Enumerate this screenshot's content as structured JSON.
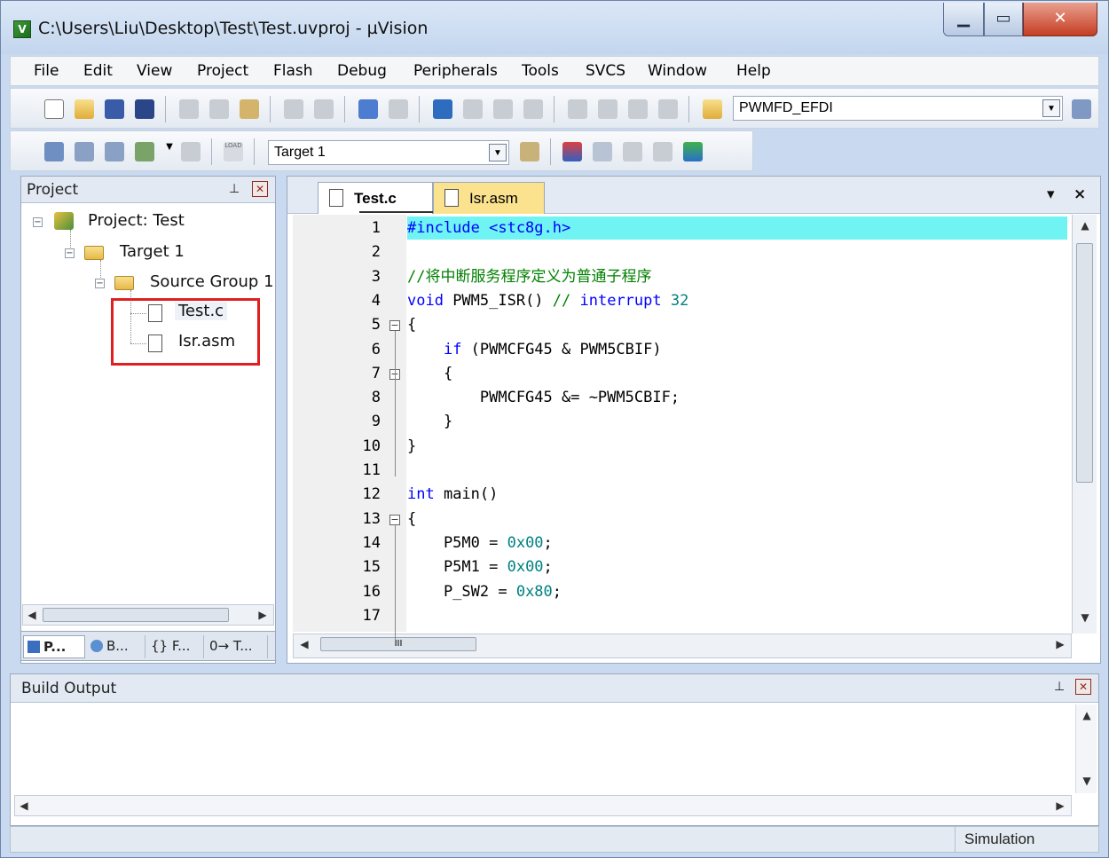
{
  "window": {
    "title": "C:\\Users\\Liu\\Desktop\\Test\\Test.uvproj - µVision",
    "app_icon_letter": "V"
  },
  "menu": [
    "File",
    "Edit",
    "View",
    "Project",
    "Flash",
    "Debug",
    "Peripherals",
    "Tools",
    "SVCS",
    "Window",
    "Help"
  ],
  "toolbar1": {
    "find_combo_value": "PWMFD_EFDI"
  },
  "toolbar2": {
    "target_combo_value": "Target 1",
    "load_label": "LOAD"
  },
  "project_panel": {
    "title": "Project",
    "tree": {
      "project": "Project: Test",
      "target": "Target 1",
      "group": "Source Group 1",
      "files": [
        "Test.c",
        "Isr.asm"
      ]
    },
    "tabs": [
      "P...",
      "B...",
      "{} F...",
      "0→ T..."
    ]
  },
  "editor": {
    "tabs": [
      {
        "label": "Test.c",
        "active": true
      },
      {
        "label": "Isr.asm",
        "active": false
      }
    ],
    "tab_menu_glyph": "▾",
    "tab_close_glyph": "×",
    "line_numbers": [
      "1",
      "2",
      "3",
      "4",
      "5",
      "6",
      "7",
      "8",
      "9",
      "10",
      "11",
      "12",
      "13",
      "14",
      "15",
      "16",
      "17"
    ],
    "lines": [
      "#include <stc8g.h>",
      "",
      "//将中断服务程序定义为普通子程序",
      "void PWM5_ISR() // interrupt 32",
      "{",
      "    if (PWMCFG45 & PWM5CBIF)",
      "    {",
      "        PWMCFG45 &= ~PWM5CBIF;",
      "    }",
      "}",
      "",
      "int main()",
      "{",
      "    P5M0 = 0x00;",
      "    P5M1 = 0x00;",
      "    P_SW2 = 0x80;",
      ""
    ],
    "scroll_mid_glyph": "III"
  },
  "build_output": {
    "title": "Build Output"
  },
  "statusbar": {
    "mode": "Simulation"
  },
  "colors": {
    "current_line": "#6ff3f3",
    "keyword": "#0000ff",
    "comment": "#008000",
    "number": "#008080",
    "include": "#0000ff",
    "highlight_box": "#e02020"
  }
}
